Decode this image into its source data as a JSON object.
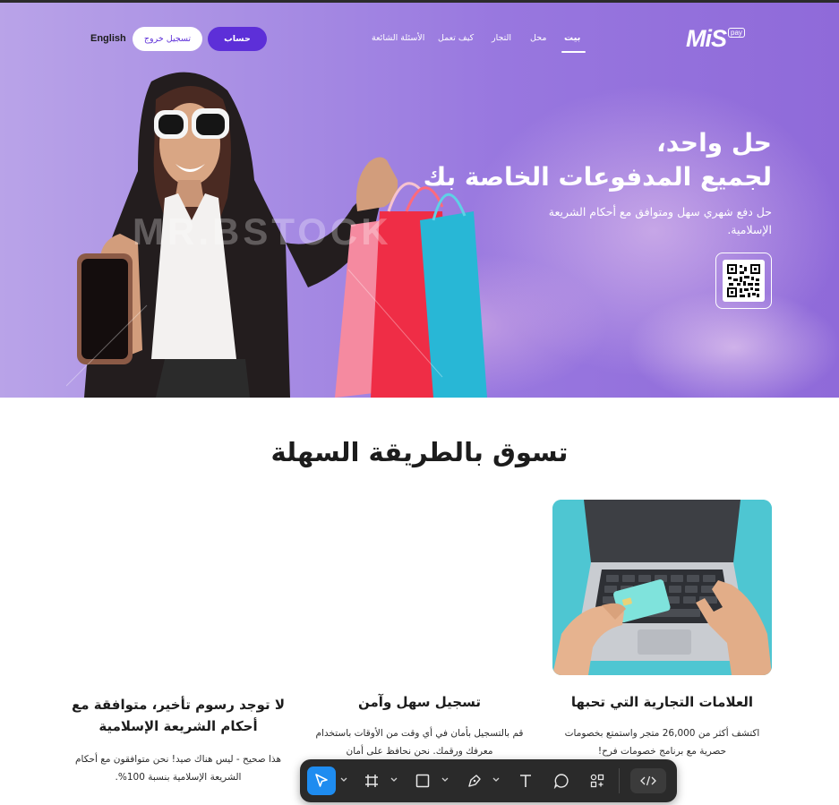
{
  "brand": {
    "logo_text": "MiS",
    "logo_sub": "pay"
  },
  "nav": {
    "home": "بيت",
    "shop": "محل",
    "merchants": "التجار",
    "how_it_works": "كيف تعمل",
    "faq": "الأسئلة الشائعة"
  },
  "header_actions": {
    "account": "حساب",
    "logout": "تسجيل خروج",
    "language": "English"
  },
  "hero": {
    "title_line1": "حل واحد،",
    "title_line2": "لجميع المدفوعات الخاصة بك",
    "subtitle": "حل دفع شهري سهل ومتوافق مع أحكام الشريعة الإسلامية.",
    "watermark": "MR.BSTOCK"
  },
  "section": {
    "title": "تسوق بالطريقة السهلة",
    "columns": [
      {
        "title": "العلامات التجارية التي تحبها",
        "text": "اكتشف أكثر من 26,000 متجر واستمتع بخصومات حصرية مع برنامج خصومات فرح!"
      },
      {
        "title": "تسجيل سهل وآمن",
        "text": "قم بالتسجيل بأمان في أي وقت من الأوقات باستخدام معرفك ورقمك. نحن نحافظ على أمان"
      },
      {
        "title": "لا توجد رسوم تأخير، متوافقة مع أحكام الشريعة الإسلامية",
        "text": "هذا صحيح - ليس هناك صيد! نحن متوافقون مع أحكام الشريعة الإسلامية بنسبة 100%."
      }
    ]
  },
  "toolbar": {
    "tools": [
      "move-tool",
      "frame-tool",
      "rectangle-tool",
      "pen-tool",
      "text-tool",
      "comment-tool",
      "components-tool",
      "code-tool"
    ],
    "active_tool": "move-tool"
  },
  "colors": {
    "accent": "#5d2fd8",
    "hero_gradient_start": "#b9a3e8",
    "hero_gradient_end": "#8f6ad9",
    "toolbar_active": "#1e8cf0"
  }
}
